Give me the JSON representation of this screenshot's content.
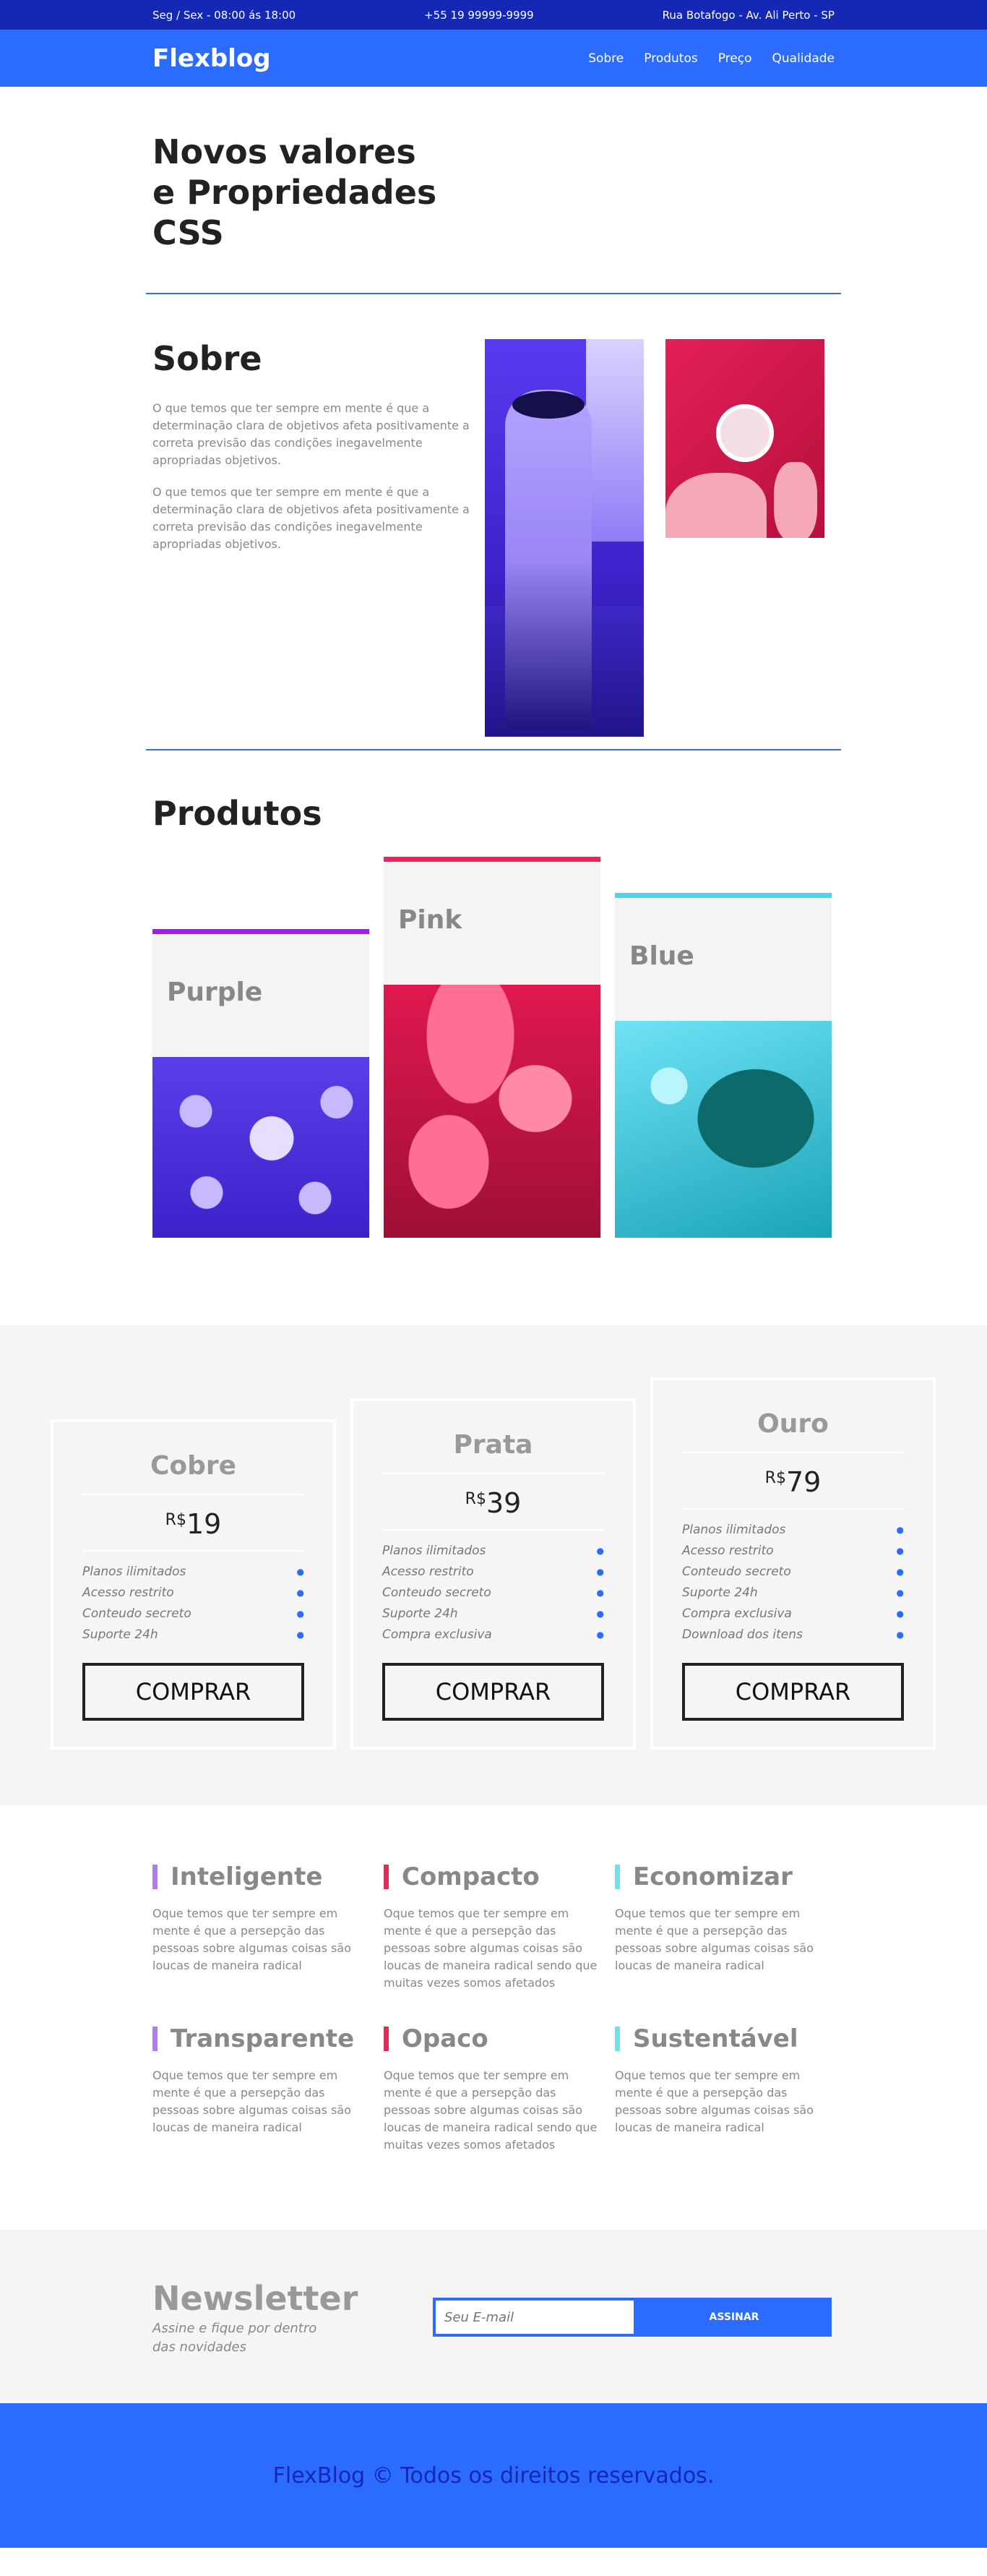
{
  "topbar": {
    "hours": "Seg / Sex - 08:00 ás 18:00",
    "phone": "+55 19 99999-9999",
    "address": "Rua Botafogo - Av. Ali Perto - SP"
  },
  "header": {
    "logo": "Flexblog",
    "nav": [
      "Sobre",
      "Produtos",
      "Preço",
      "Qualidade"
    ]
  },
  "intro": {
    "title": "Novos valores e Propriedades CSS"
  },
  "sobre": {
    "title": "Sobre",
    "paragraphs": [
      "O que temos que ter sempre em mente é que a determinação clara de objetivos afeta positivamente a correta previsão das condições inegavelmente apropriadas objetivos.",
      "O que temos que ter sempre em mente é que a determinação clara de objetivos afeta positivamente a correta previsão das condições inegavelmente apropriadas objetivos."
    ]
  },
  "produtos": {
    "title": "Produtos",
    "items": [
      {
        "name": "Purple",
        "color": "#a21cf0"
      },
      {
        "name": "Pink",
        "color": "#f0245a"
      },
      {
        "name": "Blue",
        "color": "#4dd3ea"
      }
    ]
  },
  "pricing": {
    "currency": "R$",
    "buy_label": "COMPRAR",
    "plans": [
      {
        "name": "Cobre",
        "price": "19",
        "features": [
          "Planos ilimitados",
          "Acesso restrito",
          "Conteudo secreto",
          "Suporte 24h"
        ]
      },
      {
        "name": "Prata",
        "price": "39",
        "features": [
          "Planos ilimitados",
          "Acesso restrito",
          "Conteudo secreto",
          "Suporte 24h",
          "Compra exclusiva"
        ]
      },
      {
        "name": "Ouro",
        "price": "79",
        "features": [
          "Planos ilimitados",
          "Acesso restrito",
          "Conteudo secreto",
          "Suporte 24h",
          "Compra exclusiva",
          "Download dos itens"
        ]
      }
    ]
  },
  "features": [
    {
      "title": "Inteligente",
      "color": "#b07cf0",
      "text": "Oque temos que ter sempre em mente é que a persepção das pessoas sobre algumas coisas são loucas de maneira radical"
    },
    {
      "title": "Compacto",
      "color": "#f0245a",
      "text": "Oque temos que ter sempre em mente é que a persepção das pessoas sobre algumas coisas são loucas de maneira radical sendo que muitas vezes somos afetados"
    },
    {
      "title": "Economizar",
      "color": "#6fe0ee",
      "text": "Oque temos que ter sempre em mente é que a persepção das pessoas sobre algumas coisas são loucas de maneira radical"
    },
    {
      "title": "Transparente",
      "color": "#b07cf0",
      "text": "Oque temos que ter sempre em mente é que a persepção das pessoas sobre algumas coisas são loucas de maneira radical"
    },
    {
      "title": "Opaco",
      "color": "#f0245a",
      "text": "Oque temos que ter sempre em mente é que a persepção das pessoas sobre algumas coisas são loucas de maneira radical sendo que muitas vezes somos afetados"
    },
    {
      "title": "Sustentável",
      "color": "#6fe0ee",
      "text": "Oque temos que ter sempre em mente é que a persepção das pessoas sobre algumas coisas são loucas de maneira radical"
    }
  ],
  "newsletter": {
    "title": "Newsletter",
    "subtitle": "Assine e fique por dentro das novidades",
    "email_placeholder": "Seu E-mail",
    "button": "ASSINAR"
  },
  "footer": {
    "text": "FlexBlog © Todos os direitos reservados."
  },
  "colors": {
    "topbar": "#1428b4",
    "primary": "#2c6bff"
  }
}
